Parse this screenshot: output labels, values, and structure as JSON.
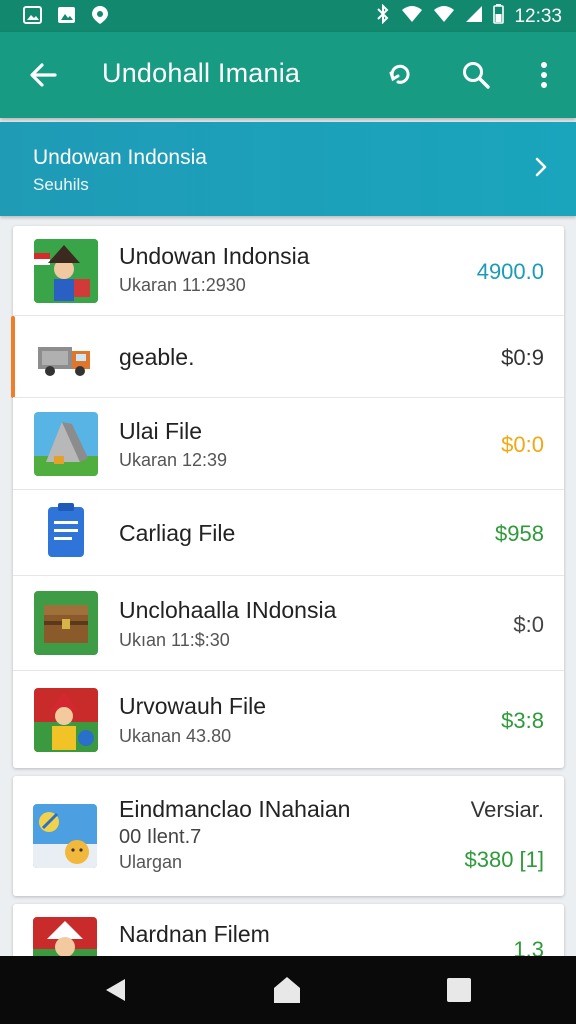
{
  "status_bar": {
    "time": "12:33",
    "left_icons": [
      "image-icon",
      "photo-icon",
      "maps-pin-icon"
    ],
    "right_icons": [
      "bluetooth-icon",
      "wifi-icon",
      "signal-icon",
      "battery-icon"
    ]
  },
  "toolbar": {
    "title": "Undohall Imania",
    "icons": [
      "back-arrow-icon",
      "sync-icon",
      "search-icon",
      "more-vert-icon"
    ]
  },
  "banner": {
    "title": "Undowan Indonsia",
    "subtitle": "Seuhils"
  },
  "card1_rows": [
    {
      "title": "Undowan Indonsia",
      "subtitle": "Ukaran 11:2930",
      "price": "4900.0",
      "price_color": "#1a9cb8"
    },
    {
      "title": "geable.",
      "subtitle": "",
      "price": "$0:9",
      "price_color": "#333333"
    },
    {
      "title": "Ulai File",
      "subtitle": "Ukaran 12:39",
      "price": "$0:0",
      "price_color": "#f3a712"
    },
    {
      "title": "Carliag File",
      "subtitle": "",
      "price": "$958",
      "price_color": "#2e9a3a"
    },
    {
      "title": "Unclohaalla INdonsia",
      "subtitle": "Ukıan 11:$:30",
      "price": "$:0",
      "price_color": "#444444"
    },
    {
      "title": "Urvowauh File",
      "subtitle": "Ukanan 43.80",
      "price": "$3:8",
      "price_color": "#2e9a3a"
    }
  ],
  "card2": {
    "title": "Eindmanclao INahaian",
    "line2": "00 Ilent.7",
    "line3": "Ulargan",
    "right_top": "Versiar.",
    "price": "$380 [1]",
    "price_color": "#2e9a3a"
  },
  "card3": {
    "title": "Nardnan Filem",
    "price": "1.3",
    "price_color": "#2e9a3a"
  },
  "colors": {
    "status_bar": "#12896f",
    "toolbar": "#179b83",
    "banner": "#1f9bb6",
    "accent_orange": "#ef7d2a"
  },
  "nav_icons": [
    "back-triangle-icon",
    "home-icon",
    "recents-square-icon"
  ]
}
